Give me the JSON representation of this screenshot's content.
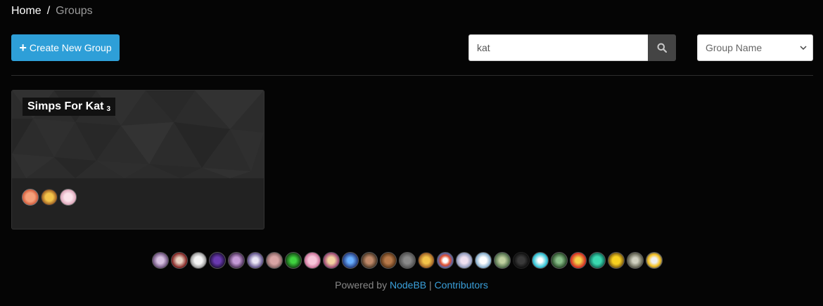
{
  "breadcrumb": {
    "home": "Home",
    "separator": "/",
    "current": "Groups"
  },
  "toolbar": {
    "create_icon": "+",
    "create_label": "Create New Group",
    "search_value": "kat",
    "search_icon": "search-icon",
    "sort_value": "Group Name",
    "sort_icon": "chevron-down-icon"
  },
  "groups": [
    {
      "name": "Simps For Kat",
      "member_count": "3"
    }
  ],
  "colors": {
    "accent": "#2e9fd8",
    "link": "#3aa0db",
    "background": "#050505",
    "card": "#222222"
  },
  "footer": {
    "powered_prefix": "Powered by",
    "nodebb_link": "NodeBB",
    "separator": "|",
    "contributors_link": "Contributors"
  }
}
